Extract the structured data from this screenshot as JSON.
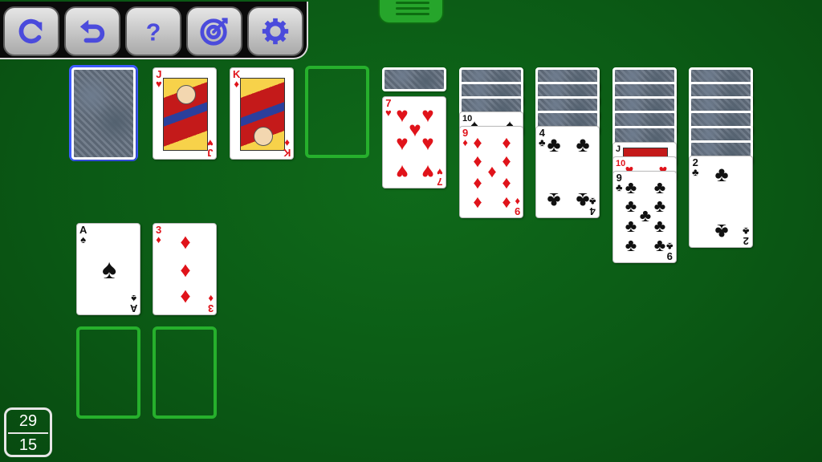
{
  "toolbar": {
    "buttons": [
      {
        "name": "new-game",
        "icon": "refresh-icon"
      },
      {
        "name": "undo",
        "icon": "undo-icon"
      },
      {
        "name": "help",
        "icon": "question-icon"
      },
      {
        "name": "hint",
        "icon": "target-icon"
      },
      {
        "name": "settings",
        "icon": "gear-icon"
      }
    ],
    "icon_color": "#4b4bdc"
  },
  "waste": [
    {
      "rank": "J",
      "suit": "♥"
    },
    {
      "rank": "K",
      "suit": "♦"
    }
  ],
  "tableau": [
    {
      "rank": "7",
      "suit": "♥"
    },
    {
      "rank": "10",
      "suit": "♠"
    },
    {
      "rank": "9",
      "suit": "♦"
    },
    {
      "rank": "4",
      "suit": "♣"
    },
    {
      "rank": "J",
      "suit": "♥"
    },
    {
      "rank": "10",
      "suit": "♥"
    },
    {
      "rank": "9",
      "suit": "♣"
    },
    {
      "rank": "2",
      "suit": "♣"
    }
  ],
  "foundations": [
    {
      "rank": "A",
      "suit": "♠"
    },
    {
      "rank": "3",
      "suit": "♦"
    }
  ],
  "counter": {
    "top": "29",
    "bottom": "15"
  }
}
